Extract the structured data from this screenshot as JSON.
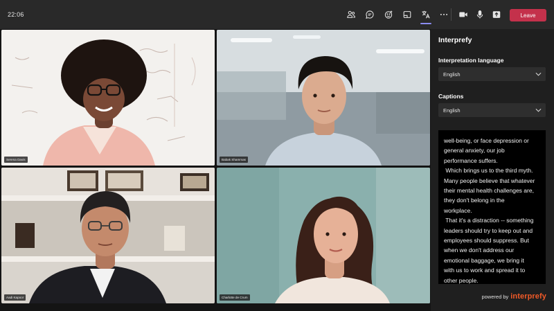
{
  "topbar": {
    "time": "22:06",
    "icons": [
      "people-icon",
      "chat-icon",
      "reactions-icon",
      "share-tray-icon",
      "translate-icon",
      "more-icon",
      "camera-icon",
      "mic-icon",
      "share-screen-icon"
    ],
    "leave_label": "Leave",
    "leave_color": "#c4314b"
  },
  "participants": [
    {
      "name": "Serena Davis"
    },
    {
      "name": "Babak Shammas"
    },
    {
      "name": "Aadi Kapoor"
    },
    {
      "name": "Charlotte de Crum"
    }
  ],
  "panel": {
    "title": "Interprefy",
    "interpretation_label": "Interpretation language",
    "interpretation_value": "English",
    "captions_label": "Captions",
    "captions_value": "English",
    "caption_lines": [
      "well-being, or face depression or",
      "general anxiety, our job",
      "performance suffers.",
      " Which brings us to the third myth.",
      "Many people believe that whatever",
      "their mental health challenges are,",
      "they don't belong in the",
      "workplace.",
      " That it's a distraction -- something",
      "leaders should try to keep out and",
      "employees should suppress. But",
      "when we don't address our",
      "emotional baggage, we bring it",
      "with us to work and spread it to",
      "other people."
    ],
    "powered_by": "powered by",
    "brand": "interprefy",
    "brand_color": "#f05a28"
  }
}
